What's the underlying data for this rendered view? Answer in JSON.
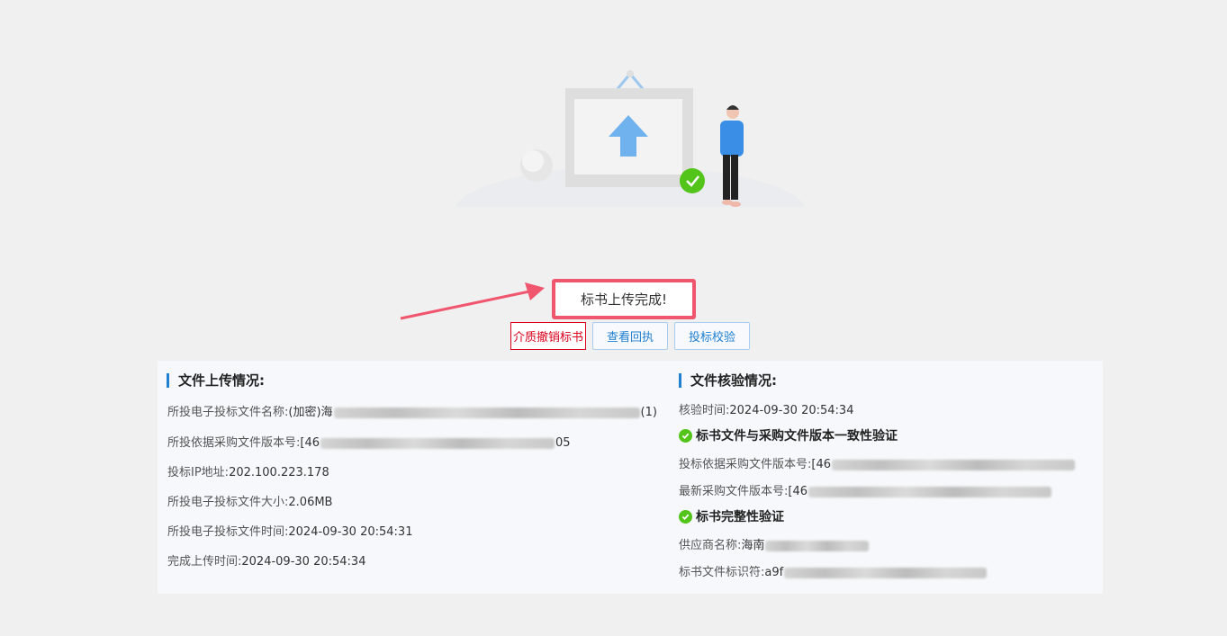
{
  "status": {
    "title": "标书上传完成!"
  },
  "actions": {
    "withdraw": "介质撤销标书",
    "view_receipt": "查看回执",
    "verify": "投标校验"
  },
  "upload_info": {
    "heading": "文件上传情况:",
    "file_name_label": "所投电子投标文件名称:",
    "file_name_prefix": "(加密)海",
    "file_name_suffix": "(1)",
    "version_label": "所投依据采购文件版本号:",
    "version_prefix": "[46",
    "version_suffix": "05",
    "ip_label": "投标IP地址:",
    "ip_value": "202.100.223.178",
    "size_label": "所投电子投标文件大小:",
    "size_value": "2.06MB",
    "file_time_label": "所投电子投标文件时间:",
    "file_time_value": "2024-09-30 20:54:31",
    "complete_label": "完成上传时间:",
    "complete_value": "2024-09-30 20:54:34"
  },
  "verify_info": {
    "heading": "文件核验情况:",
    "time_label": "核验时间:",
    "time_value": "2024-09-30 20:54:34",
    "check1": "标书文件与采购文件版本一致性验证",
    "bid_version_label": "投标依据采购文件版本号:",
    "bid_version_prefix": "[46",
    "latest_version_label": "最新采购文件版本号:",
    "latest_version_prefix": "[46",
    "check2": "标书完整性验证",
    "supplier_label": "供应商名称:",
    "supplier_prefix": "海南",
    "file_id_label": "标书文件标识符:",
    "file_id_prefix": "a9f"
  }
}
